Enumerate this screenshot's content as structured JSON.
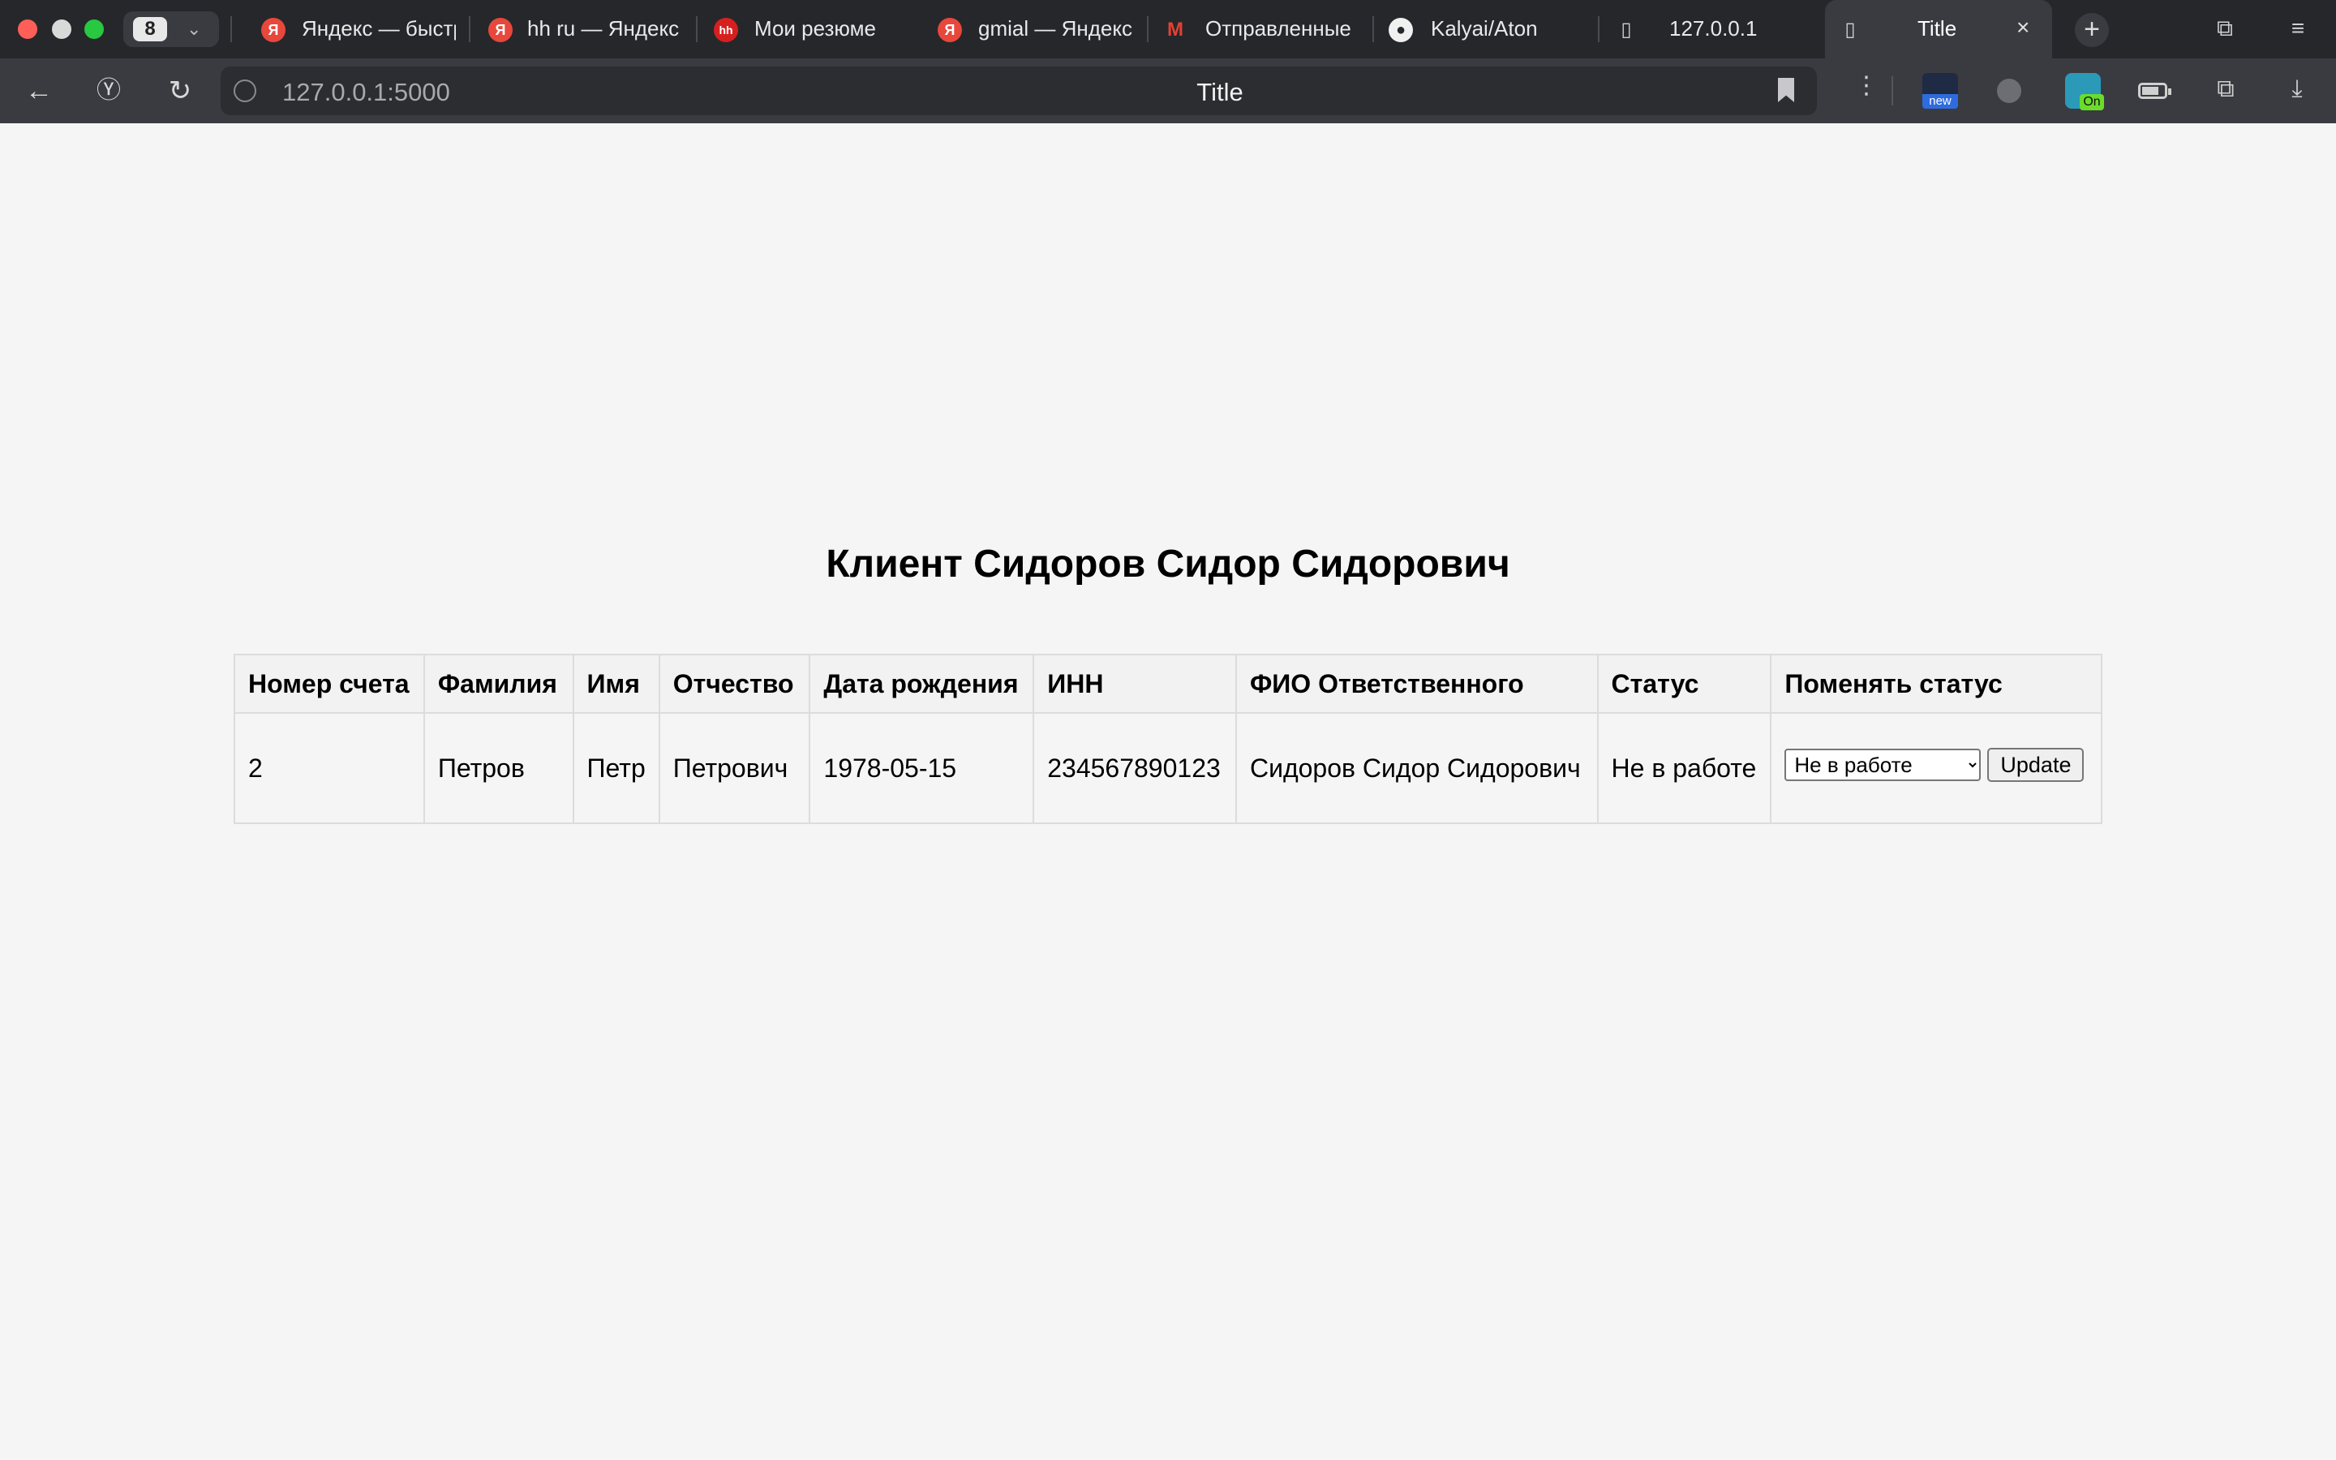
{
  "browser": {
    "tab_count": "8",
    "tabs": [
      {
        "label": "Яндекс — быстр",
        "icon": "yandex-icon"
      },
      {
        "label": "hh ru — Яндекс",
        "icon": "yandex-icon"
      },
      {
        "label": "Мои резюме",
        "icon": "hh-icon"
      },
      {
        "label": "gmial — Яндекс",
        "icon": "yandex-icon"
      },
      {
        "label": "Отправленные",
        "icon": "gmail-icon"
      },
      {
        "label": "Kalyai/Aton",
        "icon": "github-icon"
      },
      {
        "label": "127.0.0.1",
        "icon": "file-icon"
      },
      {
        "label": "Title",
        "icon": "file-icon",
        "active": true
      }
    ],
    "url": "127.0.0.1:5000",
    "page_title": "Title",
    "extensions": {
      "new_badge": "new",
      "on_badge": "On"
    },
    "colors": {
      "chrome": "#26272b",
      "active_tab": "#3a3b40",
      "yandex_red": "#e8473c"
    }
  },
  "page": {
    "heading": "Клиент Сидоров Сидор Сидорович",
    "table": {
      "columns": [
        "Номер счета",
        "Фамилия",
        "Имя",
        "Отчество",
        "Дата рождения",
        "ИНН",
        "ФИО Ответственного",
        "Статус",
        "Поменять статус"
      ],
      "rows": [
        {
          "account": "2",
          "last_name": "Петров",
          "first_name": "Петр",
          "patronymic": "Петрович",
          "birth_date": "1978-05-15",
          "inn": "234567890123",
          "responsible": "Сидоров Сидор Сидорович",
          "status": "Не в работе",
          "select_value": "Не в работе",
          "button": "Update"
        }
      ]
    }
  }
}
